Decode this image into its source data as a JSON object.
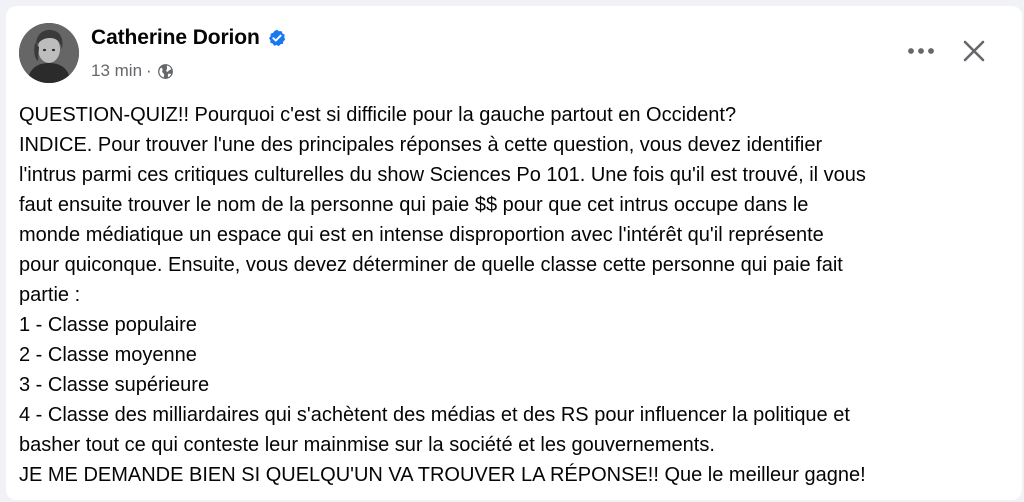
{
  "post": {
    "author": {
      "name": "Catherine Dorion",
      "verified": true,
      "avatar_icon": "profile-photo"
    },
    "timestamp": "13 min",
    "separator": "·",
    "audience_icon": "globe-icon",
    "header_actions": {
      "more_icon": "more-horizontal-icon",
      "close_icon": "close-icon"
    },
    "body_lines": [
      "QUESTION-QUIZ!! Pourquoi c'est si difficile pour la gauche partout en Occident?",
      "INDICE. Pour trouver l'une des principales réponses à cette question, vous devez identifier",
      "l'intrus parmi ces critiques culturelles du show Sciences Po 101. Une fois qu'il est trouvé, il vous",
      "faut ensuite trouver le nom de la personne qui paie $$ pour que cet intrus occupe dans le",
      "monde médiatique un espace qui est en intense disproportion avec l'intérêt qu'il représente",
      "pour quiconque. Ensuite, vous devez déterminer de quelle classe cette personne qui paie fait",
      "partie :",
      "1 - Classe populaire",
      "2 - Classe moyenne",
      "3 - Classe supérieure",
      "4 - Classe des milliardaires qui s'achètent des médias et des RS pour influencer la politique et",
      "basher tout ce qui conteste leur mainmise sur la société et les gouvernements.",
      "JE ME DEMANDE BIEN SI QUELQU'UN VA TROUVER LA RÉPONSE!! Que le meilleur gagne!"
    ]
  },
  "colors": {
    "page_background": "#f0f2f5",
    "card_background": "#ffffff",
    "text_primary": "#050505",
    "text_secondary": "#65676b",
    "verified_blue": "#1877f2"
  }
}
